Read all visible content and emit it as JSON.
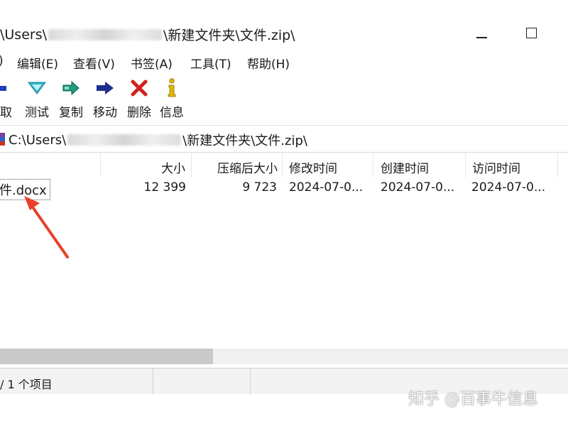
{
  "window": {
    "title_prefix": "\\Users\\",
    "title_suffix": "\\新建文件夹\\文件.zip\\"
  },
  "menu": {
    "items": [
      {
        "label": ")"
      },
      {
        "label": "编辑(E)"
      },
      {
        "label": "查看(V)"
      },
      {
        "label": "书签(A)"
      },
      {
        "label": "工具(T)"
      },
      {
        "label": "帮助(H)"
      }
    ]
  },
  "toolbar": {
    "items": [
      {
        "label": "提取",
        "icon": "extract-icon"
      },
      {
        "label": "测试",
        "icon": "test-icon"
      },
      {
        "label": "复制",
        "icon": "copy-icon"
      },
      {
        "label": "移动",
        "icon": "move-icon"
      },
      {
        "label": "删除",
        "icon": "delete-icon"
      },
      {
        "label": "信息",
        "icon": "info-icon"
      }
    ]
  },
  "address": {
    "prefix": "C:\\Users\\",
    "suffix": "\\新建文件夹\\文件.zip\\"
  },
  "list": {
    "columns": [
      "大小",
      "压缩后大小",
      "修改时间",
      "创建时间",
      "访问时间"
    ],
    "rows": [
      {
        "name": "件.docx",
        "size": "12 399",
        "packed_size": "9 723",
        "modified": "2024-07-0...",
        "created": "2024-07-0...",
        "accessed": "2024-07-0..."
      }
    ]
  },
  "status": {
    "text": "/ 1 个项目"
  },
  "watermark": "知乎 @百事牛信息",
  "colors": {
    "arrow": "#e8402a",
    "test_icon": "#2fb5c9",
    "copy_icon": "#1f9c7a",
    "move_icon": "#1e2f8c",
    "delete_icon": "#d42020",
    "info_icon": "#e0b800"
  }
}
